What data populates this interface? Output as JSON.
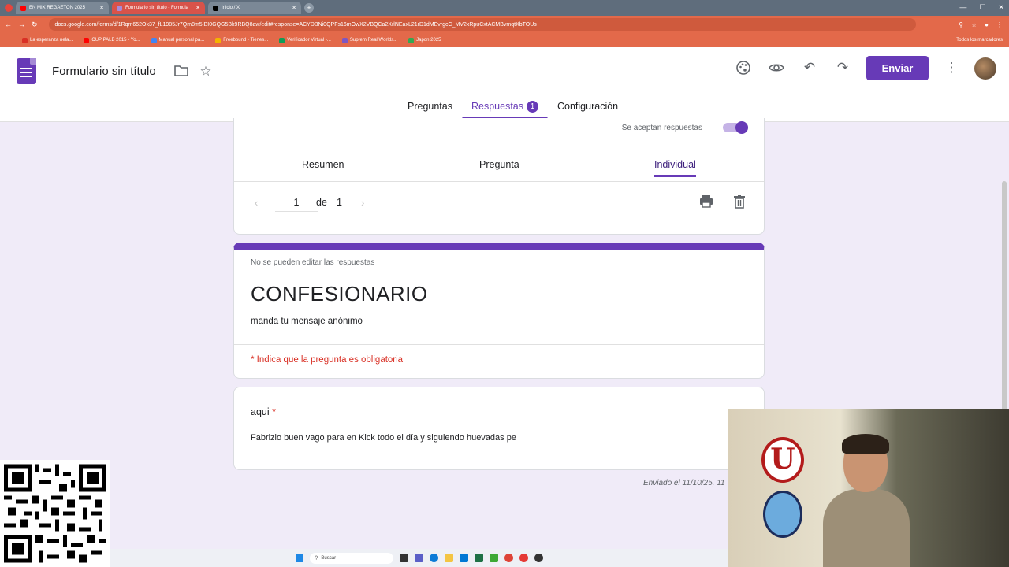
{
  "browser": {
    "tabs": [
      {
        "label": "EN MIX REGAETON 2025"
      },
      {
        "label": "Formulario sin título - Formula"
      },
      {
        "label": "Inicio / X"
      }
    ],
    "url": "docs.google.com/forms/d/1Rqm652Ok37_fL1985Jr7Qm8m5IBI0GQG5Bk9RBQ8aw/edit#response=ACYDBNi0QPFs16mOwX2VBQCa2XrlNEaxL21rD1dMEvrgcC_MV2xRpuCxtACMBvmqtXbTOUs",
    "bookmarks": [
      {
        "label": "La esperanza nela..."
      },
      {
        "label": "CUP PALB 2015 - Yo..."
      },
      {
        "label": "Manual personal pa..."
      },
      {
        "label": "Freebound - Tienes..."
      },
      {
        "label": "Verificador Virtual -..."
      },
      {
        "label": "Suprem Real Worlds..."
      },
      {
        "label": "Japon 2025"
      }
    ],
    "bookmarks_right": "Todos los marcadores"
  },
  "app": {
    "title": "Formulario sin título",
    "send_label": "Enviar",
    "main_tabs": [
      {
        "label": "Preguntas"
      },
      {
        "label": "Respuestas",
        "badge": "1"
      },
      {
        "label": "Configuración"
      }
    ]
  },
  "responses": {
    "accepting_label": "Se aceptan respuestas",
    "accepting": true,
    "sub_tabs": [
      {
        "label": "Resumen"
      },
      {
        "label": "Pregunta"
      },
      {
        "label": "Individual"
      }
    ],
    "pager": {
      "current": "1",
      "of_label": "de",
      "total": "1"
    }
  },
  "form": {
    "no_edit_notice": "No se pueden editar las respuestas",
    "title": "CONFESIONARIO",
    "description": "manda tu mensaje anónimo",
    "required_notice": "* Indica que la pregunta es obligatoria",
    "question": {
      "label": "aqui",
      "required_mark": "*",
      "answer": "Fabrizio buen vago para en Kick todo el día y siguiendo huevadas pe"
    },
    "submitted": "Enviado el 11/10/25, 11"
  },
  "taskbar": {
    "search_placeholder": "Buscar"
  },
  "webcam": {
    "crest_letter": "U"
  },
  "colors": {
    "accent": "#673ab7",
    "required": "#d93025",
    "background": "#f0ebf8"
  }
}
